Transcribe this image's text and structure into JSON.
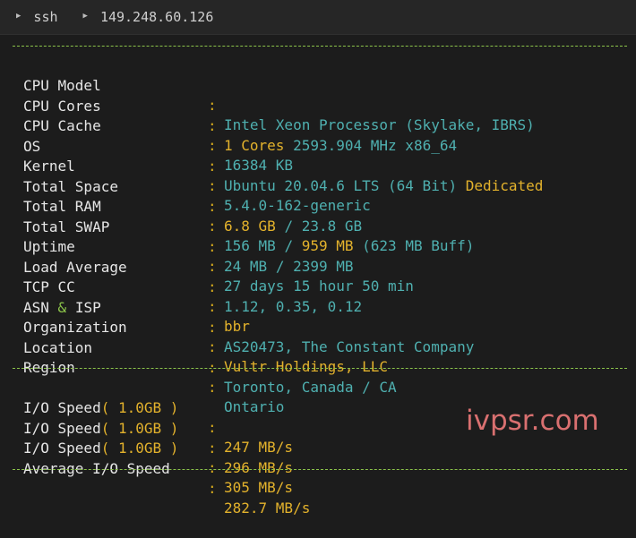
{
  "breadcrumb": {
    "items": [
      "ssh",
      "149.248.60.126"
    ]
  },
  "separator": "--------------------------------------------------------------------------------",
  "sysinfo": {
    "cpu_model": {
      "label": "CPU Model",
      "value": "Intel Xeon Processor (Skylake, IBRS)"
    },
    "cpu_cores": {
      "label": "CPU Cores",
      "cores": "1 Cores",
      "freq": "2593.904 MHz x86_64"
    },
    "cpu_cache": {
      "label": "CPU Cache",
      "value": "16384 KB"
    },
    "os": {
      "label": "OS",
      "value": "Ubuntu 20.04.6 LTS (64 Bit)",
      "extra": "Dedicated"
    },
    "kernel": {
      "label": "Kernel",
      "value": "5.4.0-162-generic"
    },
    "total_space": {
      "label": "Total Space",
      "used": "6.8 GB",
      "sep": "/",
      "total": "23.8 GB"
    },
    "total_ram": {
      "label": "Total RAM",
      "used": "156 MB",
      "sep": "/",
      "total": "959 MB",
      "buff": "(623 MB Buff)"
    },
    "total_swap": {
      "label": "Total SWAP",
      "used": "24 MB",
      "sep": "/",
      "total": "2399 MB"
    },
    "uptime": {
      "label": "Uptime",
      "value": "27 days 15 hour 50 min"
    },
    "load_average": {
      "label": "Load Average",
      "value": "1.12, 0.35, 0.12"
    },
    "tcp_cc": {
      "label": "TCP CC",
      "value": "bbr"
    },
    "asn_isp": {
      "label_a": "ASN",
      "label_amp": "&",
      "label_b": "ISP",
      "value": "AS20473, The Constant Company"
    },
    "organization": {
      "label": "Organization",
      "value": "Vultr Holdings, LLC"
    },
    "location": {
      "label": "Location",
      "value": "Toronto, Canada / CA"
    },
    "region": {
      "label": "Region",
      "value": "Ontario"
    }
  },
  "io": {
    "runs": [
      {
        "label": "I/O Speed",
        "size": "( 1.0GB )",
        "value": "247 MB/s"
      },
      {
        "label": "I/O Speed",
        "size": "( 1.0GB )",
        "value": "296 MB/s"
      },
      {
        "label": "I/O Speed",
        "size": "( 1.0GB )",
        "value": "305 MB/s"
      }
    ],
    "average": {
      "label": "Average I/O Speed",
      "value": "282.7 MB/s"
    }
  },
  "colon": ":",
  "watermark": "ivpsr.com",
  "colors": {
    "cyan": "#4fb0b0",
    "yellow": "#e3b22c",
    "green": "#8bc34a",
    "watermark": "#d97070"
  }
}
